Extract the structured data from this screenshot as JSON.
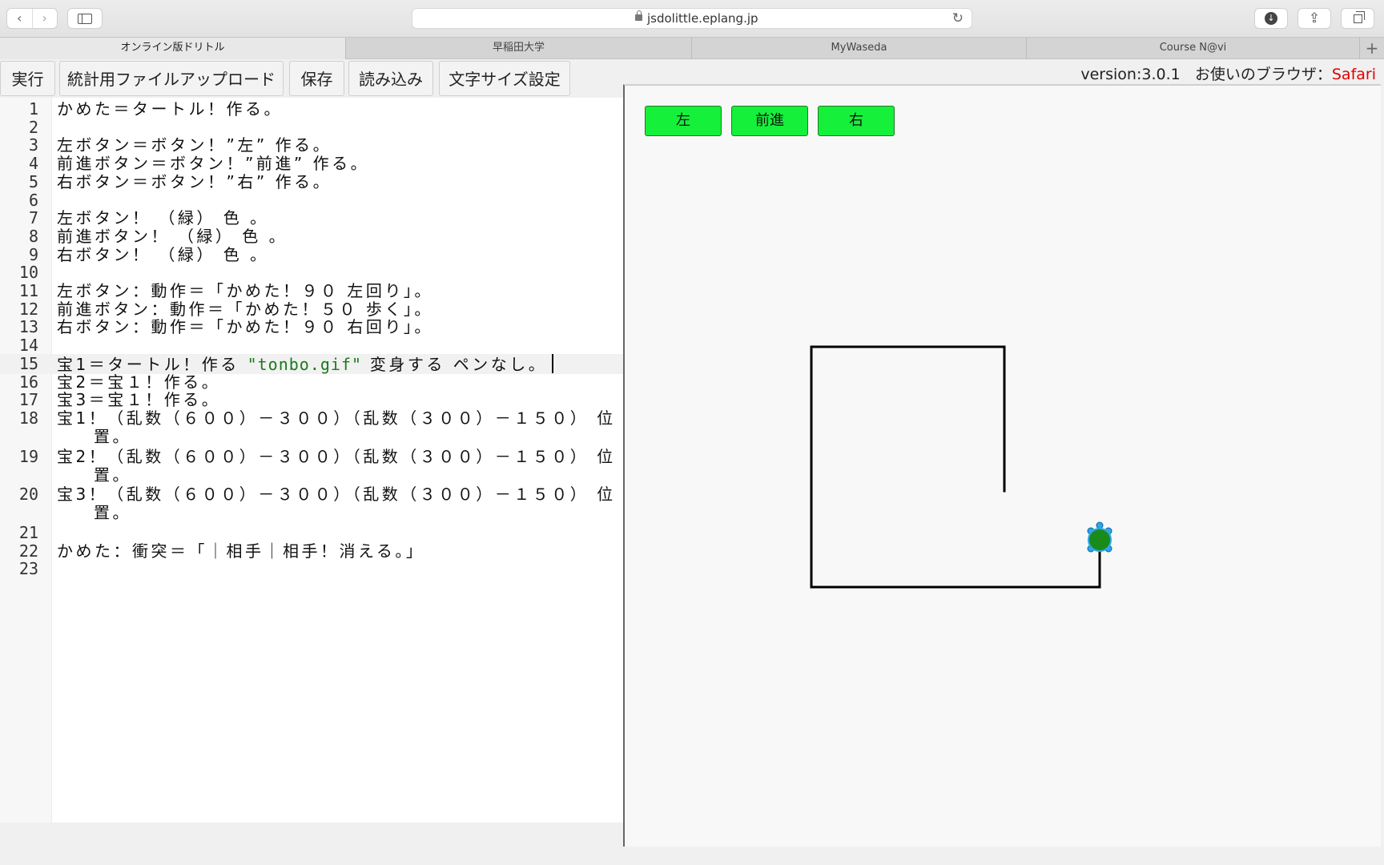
{
  "browser": {
    "url": "jsdolittle.eplang.jp",
    "nav_back": "‹",
    "nav_forward": "›",
    "reload": "↻",
    "download_glyph": "↓",
    "share_glyph": "⇪",
    "new_tab": "+",
    "icons": [
      "back-icon",
      "forward-icon",
      "sidebar-icon",
      "lock-icon",
      "reload-icon",
      "download-icon",
      "share-icon",
      "tab-overview-icon"
    ]
  },
  "tabs": [
    {
      "label": "オンライン版ドリトル",
      "active": true
    },
    {
      "label": "早稲田大学",
      "active": false
    },
    {
      "label": "MyWaseda",
      "active": false
    },
    {
      "label": "Course N@vi",
      "active": false
    }
  ],
  "toolbar": {
    "run_label": "実行",
    "upload_label": "統計用ファイルアップロード",
    "save_label": "保存",
    "load_label": "読み込み",
    "font_size_label": "文字サイズ設定"
  },
  "version_info": {
    "version": "version:3.0.1",
    "browser_label": "お使いのブラウザ：",
    "browser_name": "Safari",
    "browser_color": "#e00000"
  },
  "editor": {
    "active_line": 15,
    "lines": [
      {
        "n": "1",
        "text": "かめた＝タートル！作る。"
      },
      {
        "n": "2",
        "text": ""
      },
      {
        "n": "3",
        "text": "左ボタン＝ボタン！”左” 作る。"
      },
      {
        "n": "4",
        "text": "前進ボタン＝ボタン！”前進” 作る。"
      },
      {
        "n": "5",
        "text": "右ボタン＝ボタン！”右” 作る。"
      },
      {
        "n": "6",
        "text": ""
      },
      {
        "n": "7",
        "text": "左ボタン！ （緑） 色 。"
      },
      {
        "n": "8",
        "text": "前進ボタン！ （緑） 色 。"
      },
      {
        "n": "9",
        "text": "右ボタン！ （緑） 色 。"
      },
      {
        "n": "10",
        "text": ""
      },
      {
        "n": "11",
        "text": "左ボタン：動作＝「かめた！９０ 左回り」。"
      },
      {
        "n": "12",
        "text": "前進ボタン：動作＝「かめた！５０ 歩く」。"
      },
      {
        "n": "13",
        "text": "右ボタン：動作＝「かめた！９０ 右回り」。"
      },
      {
        "n": "14",
        "text": ""
      },
      {
        "n": "15",
        "text_before": "宝1＝タートル！作る ",
        "string": "\"tonbo.gif\"",
        "text_after": " 変身する ペンなし。"
      },
      {
        "n": "16",
        "text": "宝2＝宝１！作る。"
      },
      {
        "n": "17",
        "text": "宝3＝宝１！作る。"
      },
      {
        "n": "18",
        "text": "宝1！（乱数（６００）－３００）（乱数（３００）－１５０） 位",
        "wrap": "置。"
      },
      {
        "n": "19",
        "text": "宝2！（乱数（６００）－３００）（乱数（３００）－１５０） 位",
        "wrap": "置。"
      },
      {
        "n": "20",
        "text": "宝3！（乱数（６００）－３００）（乱数（３００）－１５０） 位",
        "wrap": "置。"
      },
      {
        "n": "21",
        "text": ""
      },
      {
        "n": "22",
        "text": "かめた：衝突＝「｜相手｜相手！消える。」"
      },
      {
        "n": "23",
        "text": ""
      }
    ]
  },
  "stage": {
    "buttons": [
      {
        "label": "左",
        "color": "#15f03a"
      },
      {
        "label": "前進",
        "color": "#15f03a"
      },
      {
        "label": "右",
        "color": "#15f03a"
      }
    ],
    "turtle_color": "#1a8a1a",
    "line_color": "#000000"
  }
}
